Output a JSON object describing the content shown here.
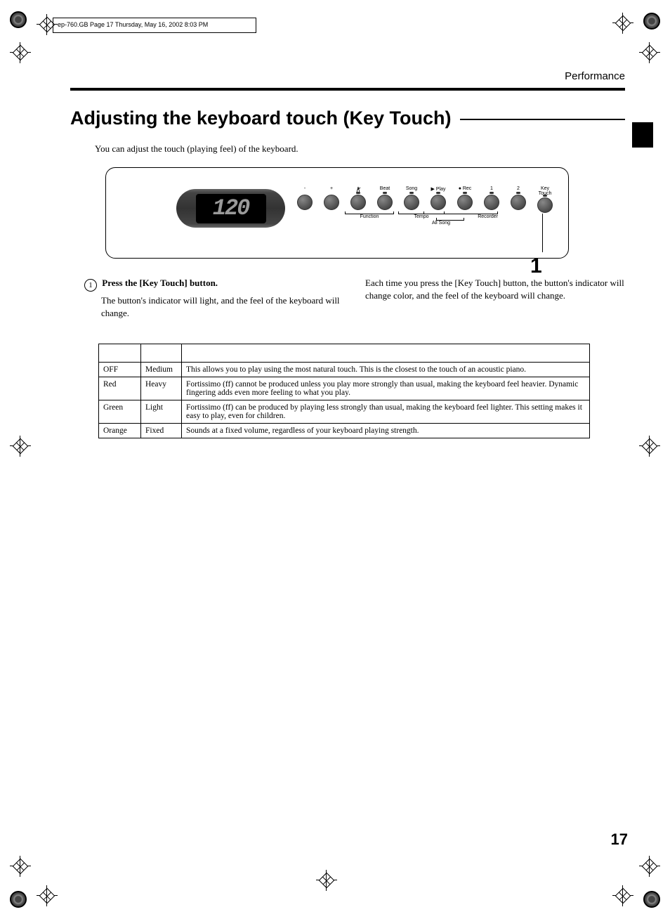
{
  "print_header": "ep-760.GB  Page 17  Thursday, May 16, 2002  8:03 PM",
  "section": "Performance",
  "title": "Adjusting the keyboard touch (Key Touch)",
  "intro": "You can adjust the touch (playing feel) of the keyboard.",
  "display_value": "120",
  "panel": {
    "minus": "-",
    "plus": "+",
    "metronome_icon": "",
    "beat": "Beat",
    "song": "Song",
    "play": "▶ Play",
    "rec": "● Rec",
    "one": "1",
    "two": "2",
    "key_touch_top": "Key",
    "key_touch_bottom": "Touch",
    "bracket_function": "Function",
    "bracket_tempo": "Tempo",
    "bracket_all_song": "All Song",
    "bracket_recorder": "Recorder"
  },
  "callout_number": "1",
  "step": {
    "num": "1",
    "heading": "Press the [Key Touch] button.",
    "body": "The button's indicator will light, and the feel of the keyboard will change."
  },
  "right_col": "Each time you press the [Key Touch] button, the button's indicator will change color, and the feel of the keyboard will change.",
  "table": {
    "empty1": "",
    "empty2": "",
    "empty3": "",
    "rows": [
      {
        "c1": "OFF",
        "c2": "Medium",
        "c3": "This allows you to play using the most natural touch. This is the closest to the touch of an acoustic piano."
      },
      {
        "c1": "Red",
        "c2": "Heavy",
        "c3": "Fortissimo (ff) cannot be produced unless you play more strongly than usual, making the keyboard feel heavier. Dynamic fingering adds even more feeling to what you play."
      },
      {
        "c1": "Green",
        "c2": "Light",
        "c3": "Fortissimo (ff) can be produced by playing less strongly than usual, making the keyboard feel lighter. This setting makes it easy to play, even for children."
      },
      {
        "c1": "Orange",
        "c2": "Fixed",
        "c3": "Sounds at a fixed volume, regardless of your keyboard playing strength."
      }
    ]
  },
  "page_number": "17"
}
